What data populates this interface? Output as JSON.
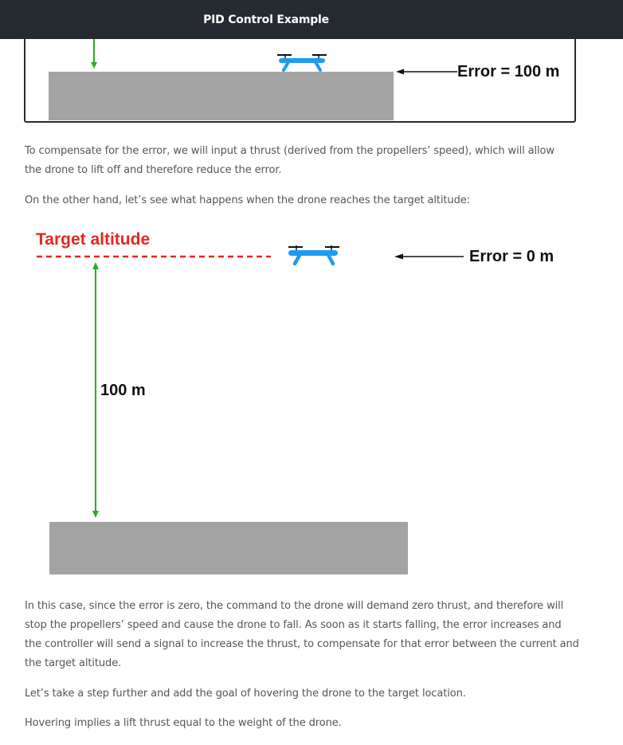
{
  "header": {
    "title": "PID Control Example"
  },
  "figure_top": {
    "error_label": "Error = 100 m"
  },
  "paragraphs": {
    "p1": "To compensate for the error, we will input a thrust (derived from the propellers’ speed), which will allow the drone to lift off and therefore reduce the error.",
    "p2": "On the other hand, let’s see what happens when the drone reaches the target altitude:",
    "p3": "In this case, since the error is zero, the command to the drone will demand zero thrust, and therefore will stop the propellers’ speed and cause the drone to fall. As soon as it starts falling, the error increases and the controller will send a signal to increase the thrust, to compensate for that error between the current and the target altitude.",
    "p4": "Let’s take a step further and add the goal of hovering the drone to the target location.",
    "p5": "Hovering implies a lift thrust equal to the weight of the drone."
  },
  "figure_main": {
    "target_label": "Target altitude",
    "error_label": "Error = 0 m",
    "distance_label": "100 m"
  },
  "colors": {
    "header_bg": "#262b32",
    "target_red": "#e8261d",
    "arrow_green": "#2aae1e",
    "drone_blue": "#1d9bf0",
    "ground_gray": "#a3a3a3"
  }
}
